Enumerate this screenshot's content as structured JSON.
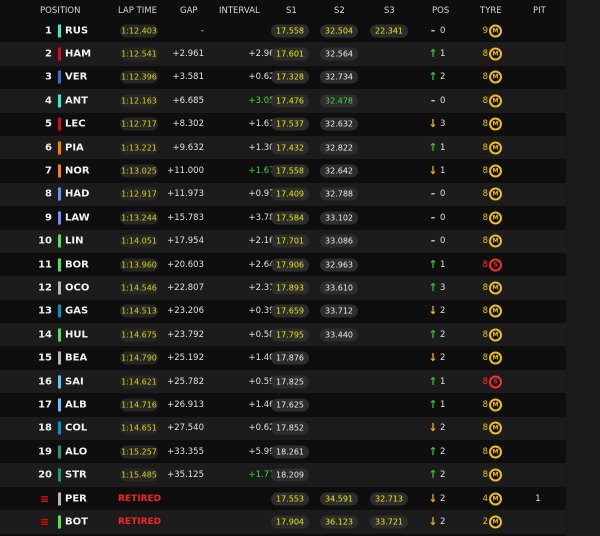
{
  "columns": {
    "position": "POSITION",
    "lap_time": "LAP TIME",
    "gap": "GAP",
    "interval": "INTERVAL",
    "s1": "S1",
    "s2": "S2",
    "s3": "S3",
    "pos": "POS",
    "tyre": "TYRE",
    "pit": "PIT"
  },
  "colors": {
    "accent_green": "#3ddc3d",
    "accent_yellow": "#e8e800",
    "retired_red": "#ff2020",
    "medium_tyre": "#f2c200",
    "soft_tyre": "#ff2a2a"
  },
  "drivers": [
    {
      "pos": "1",
      "code": "RUS",
      "team_color": "#27f4d2",
      "lap": "1:12.403",
      "gap": "-",
      "interval": "-",
      "interval_color": "white",
      "s1": "17.558",
      "s1_color": "yellow",
      "s2": "32.504",
      "s2_color": "yellow",
      "s3": "22.341",
      "s3_color": "yellow",
      "arrow": "-",
      "arrow_dir": "none",
      "pos_change": "0",
      "tyre_count": "9",
      "tyre_letter": "M",
      "tyre_type": "medium",
      "pit": ""
    },
    {
      "pos": "2",
      "code": "HAM",
      "team_color": "#e8002d",
      "lap": "1:12.541",
      "gap": "+2.961",
      "interval": "+2.961",
      "interval_color": "white",
      "s1": "17.601",
      "s1_color": "yellow",
      "s2": "32.564",
      "s2_color": "white",
      "s3": "",
      "s3_color": "white",
      "arrow": "↑",
      "arrow_dir": "up",
      "pos_change": "1",
      "tyre_count": "8",
      "tyre_letter": "M",
      "tyre_type": "medium",
      "pit": ""
    },
    {
      "pos": "3",
      "code": "VER",
      "team_color": "#3671c6",
      "lap": "1:12.396",
      "gap": "+3.581",
      "interval": "+0.620",
      "interval_color": "white",
      "s1": "17.328",
      "s1_color": "yellow",
      "s2": "32.734",
      "s2_color": "white",
      "s3": "",
      "s3_color": "white",
      "arrow": "↑",
      "arrow_dir": "up",
      "pos_change": "2",
      "tyre_count": "8",
      "tyre_letter": "M",
      "tyre_type": "medium",
      "pit": ""
    },
    {
      "pos": "4",
      "code": "ANT",
      "team_color": "#27f4d2",
      "lap": "1:12.163",
      "gap": "+6.685",
      "interval": "+3.056",
      "interval_color": "green",
      "s1": "17.476",
      "s1_color": "yellow",
      "s2": "32.478",
      "s2_color": "green",
      "s3": "",
      "s3_color": "white",
      "arrow": "-",
      "arrow_dir": "none",
      "pos_change": "0",
      "tyre_count": "8",
      "tyre_letter": "M",
      "tyre_type": "medium",
      "pit": ""
    },
    {
      "pos": "5",
      "code": "LEC",
      "team_color": "#e8002d",
      "lap": "1:12.717",
      "gap": "+8.302",
      "interval": "+1.617",
      "interval_color": "white",
      "s1": "17.537",
      "s1_color": "yellow",
      "s2": "32.632",
      "s2_color": "white",
      "s3": "",
      "s3_color": "white",
      "arrow": "↓",
      "arrow_dir": "down",
      "pos_change": "3",
      "tyre_count": "8",
      "tyre_letter": "M",
      "tyre_type": "medium",
      "pit": ""
    },
    {
      "pos": "6",
      "code": "PIA",
      "team_color": "#ff8000",
      "lap": "1:13.221",
      "gap": "+9.632",
      "interval": "+1.306",
      "interval_color": "white",
      "s1": "17.432",
      "s1_color": "yellow",
      "s2": "32.822",
      "s2_color": "white",
      "s3": "",
      "s3_color": "white",
      "arrow": "↑",
      "arrow_dir": "up",
      "pos_change": "1",
      "tyre_count": "8",
      "tyre_letter": "M",
      "tyre_type": "medium",
      "pit": ""
    },
    {
      "pos": "7",
      "code": "NOR",
      "team_color": "#ff8000",
      "lap": "1:13.025",
      "gap": "+11.000",
      "interval": "+1.672",
      "interval_color": "green",
      "s1": "17.558",
      "s1_color": "yellow",
      "s2": "32.642",
      "s2_color": "white",
      "s3": "",
      "s3_color": "white",
      "arrow": "↓",
      "arrow_dir": "down",
      "pos_change": "1",
      "tyre_count": "8",
      "tyre_letter": "M",
      "tyre_type": "medium",
      "pit": ""
    },
    {
      "pos": "8",
      "code": "HAD",
      "team_color": "#6692ff",
      "lap": "1:12.917",
      "gap": "+11.973",
      "interval": "+0.973",
      "interval_color": "white",
      "s1": "17.409",
      "s1_color": "yellow",
      "s2": "32.788",
      "s2_color": "white",
      "s3": "",
      "s3_color": "white",
      "arrow": "-",
      "arrow_dir": "none",
      "pos_change": "0",
      "tyre_count": "8",
      "tyre_letter": "M",
      "tyre_type": "medium",
      "pit": ""
    },
    {
      "pos": "9",
      "code": "LAW",
      "team_color": "#6692ff",
      "lap": "1:13.244",
      "gap": "+15.783",
      "interval": "+3.786",
      "interval_color": "white",
      "s1": "17.584",
      "s1_color": "yellow",
      "s2": "33.102",
      "s2_color": "white",
      "s3": "",
      "s3_color": "white",
      "arrow": "-",
      "arrow_dir": "none",
      "pos_change": "0",
      "tyre_count": "8",
      "tyre_letter": "M",
      "tyre_type": "medium",
      "pit": ""
    },
    {
      "pos": "10",
      "code": "LIN",
      "team_color": "#52e252",
      "lap": "1:14.051",
      "gap": "+17.954",
      "interval": "+2.163",
      "interval_color": "white",
      "s1": "17.701",
      "s1_color": "yellow",
      "s2": "33.086",
      "s2_color": "white",
      "s3": "",
      "s3_color": "white",
      "arrow": "-",
      "arrow_dir": "none",
      "pos_change": "0",
      "tyre_count": "8",
      "tyre_letter": "M",
      "tyre_type": "medium",
      "pit": ""
    },
    {
      "pos": "11",
      "code": "BOR",
      "team_color": "#52e252",
      "lap": "1:13.960",
      "gap": "+20.603",
      "interval": "+2.649",
      "interval_color": "white",
      "s1": "17.906",
      "s1_color": "yellow",
      "s2": "32.963",
      "s2_color": "white",
      "s3": "",
      "s3_color": "white",
      "arrow": "↑",
      "arrow_dir": "up",
      "pos_change": "1",
      "tyre_count": "8",
      "tyre_letter": "S",
      "tyre_type": "soft",
      "pit": ""
    },
    {
      "pos": "12",
      "code": "OCO",
      "team_color": "#b6babd",
      "lap": "1:14.546",
      "gap": "+22.807",
      "interval": "+2.319",
      "interval_color": "white",
      "s1": "17.893",
      "s1_color": "yellow",
      "s2": "33.610",
      "s2_color": "white",
      "s3": "",
      "s3_color": "white",
      "arrow": "↑",
      "arrow_dir": "up",
      "pos_change": "3",
      "tyre_count": "8",
      "tyre_letter": "M",
      "tyre_type": "medium",
      "pit": ""
    },
    {
      "pos": "13",
      "code": "GAS",
      "team_color": "#0093cc",
      "lap": "1:14.513",
      "gap": "+23.206",
      "interval": "+0.399",
      "interval_color": "white",
      "s1": "17.659",
      "s1_color": "yellow",
      "s2": "33.712",
      "s2_color": "white",
      "s3": "",
      "s3_color": "white",
      "arrow": "↓",
      "arrow_dir": "down",
      "pos_change": "2",
      "tyre_count": "8",
      "tyre_letter": "M",
      "tyre_type": "medium",
      "pit": ""
    },
    {
      "pos": "14",
      "code": "HUL",
      "team_color": "#52e252",
      "lap": "1:14.675",
      "gap": "+23.792",
      "interval": "+0.586",
      "interval_color": "white",
      "s1": "17.795",
      "s1_color": "yellow",
      "s2": "33.440",
      "s2_color": "white",
      "s3": "",
      "s3_color": "white",
      "arrow": "↑",
      "arrow_dir": "up",
      "pos_change": "2",
      "tyre_count": "8",
      "tyre_letter": "M",
      "tyre_type": "medium",
      "pit": ""
    },
    {
      "pos": "15",
      "code": "BEA",
      "team_color": "#b6babd",
      "lap": "1:14.790",
      "gap": "+25.192",
      "interval": "+1.400",
      "interval_color": "white",
      "s1": "17.876",
      "s1_color": "white",
      "s2": "",
      "s2_color": "white",
      "s3": "",
      "s3_color": "white",
      "arrow": "↓",
      "arrow_dir": "down",
      "pos_change": "2",
      "tyre_count": "8",
      "tyre_letter": "M",
      "tyre_type": "medium",
      "pit": ""
    },
    {
      "pos": "16",
      "code": "SAI",
      "team_color": "#64c4ff",
      "lap": "1:14.621",
      "gap": "+25.782",
      "interval": "+0.590",
      "interval_color": "white",
      "s1": "17.825",
      "s1_color": "white",
      "s2": "",
      "s2_color": "white",
      "s3": "",
      "s3_color": "white",
      "arrow": "↑",
      "arrow_dir": "up",
      "pos_change": "1",
      "tyre_count": "8",
      "tyre_letter": "S",
      "tyre_type": "soft",
      "pit": ""
    },
    {
      "pos": "17",
      "code": "ALB",
      "team_color": "#64c4ff",
      "lap": "1:14.716",
      "gap": "+26.913",
      "interval": "+1.464",
      "interval_color": "white",
      "s1": "17.625",
      "s1_color": "white",
      "s2": "",
      "s2_color": "white",
      "s3": "",
      "s3_color": "white",
      "arrow": "↑",
      "arrow_dir": "up",
      "pos_change": "1",
      "tyre_count": "8",
      "tyre_letter": "M",
      "tyre_type": "medium",
      "pit": ""
    },
    {
      "pos": "18",
      "code": "COL",
      "team_color": "#0093cc",
      "lap": "1:14.651",
      "gap": "+27.540",
      "interval": "+0.627",
      "interval_color": "white",
      "s1": "17.852",
      "s1_color": "white",
      "s2": "",
      "s2_color": "white",
      "s3": "",
      "s3_color": "white",
      "arrow": "↓",
      "arrow_dir": "down",
      "pos_change": "2",
      "tyre_count": "8",
      "tyre_letter": "M",
      "tyre_type": "medium",
      "pit": ""
    },
    {
      "pos": "19",
      "code": "ALO",
      "team_color": "#229971",
      "lap": "1:15.257",
      "gap": "+33.355",
      "interval": "+5.998",
      "interval_color": "white",
      "s1": "18.261",
      "s1_color": "white",
      "s2": "",
      "s2_color": "white",
      "s3": "",
      "s3_color": "white",
      "arrow": "↑",
      "arrow_dir": "up",
      "pos_change": "2",
      "tyre_count": "8",
      "tyre_letter": "M",
      "tyre_type": "medium",
      "pit": ""
    },
    {
      "pos": "20",
      "code": "STR",
      "team_color": "#229971",
      "lap": "1:15.485",
      "gap": "+35.125",
      "interval": "+1.770",
      "interval_color": "green",
      "s1": "18.209",
      "s1_color": "white",
      "s2": "",
      "s2_color": "white",
      "s3": "",
      "s3_color": "white",
      "arrow": "↑",
      "arrow_dir": "up",
      "pos_change": "2",
      "tyre_count": "8",
      "tyre_letter": "M",
      "tyre_type": "medium",
      "pit": ""
    },
    {
      "pos": "",
      "code": "PER",
      "team_color": "#b6babd",
      "retired": "RETIRED",
      "lap": "",
      "gap": "",
      "interval": "",
      "interval_color": "white",
      "s1": "17.553",
      "s1_color": "yellow",
      "s2": "34.591",
      "s2_color": "yellow",
      "s3": "32.713",
      "s3_color": "yellow",
      "arrow": "↓",
      "arrow_dir": "down",
      "pos_change": "2",
      "tyre_count": "4",
      "tyre_letter": "M",
      "tyre_type": "medium",
      "pit": "1"
    },
    {
      "pos": "",
      "code": "BOT",
      "team_color": "#52e252",
      "retired": "RETIRED",
      "lap": "",
      "gap": "",
      "interval": "",
      "interval_color": "white",
      "s1": "17.904",
      "s1_color": "yellow",
      "s2": "36.123",
      "s2_color": "yellow",
      "s3": "33.721",
      "s3_color": "yellow",
      "arrow": "↓",
      "arrow_dir": "down",
      "pos_change": "2",
      "tyre_count": "2",
      "tyre_letter": "M",
      "tyre_type": "medium",
      "pit": ""
    }
  ]
}
